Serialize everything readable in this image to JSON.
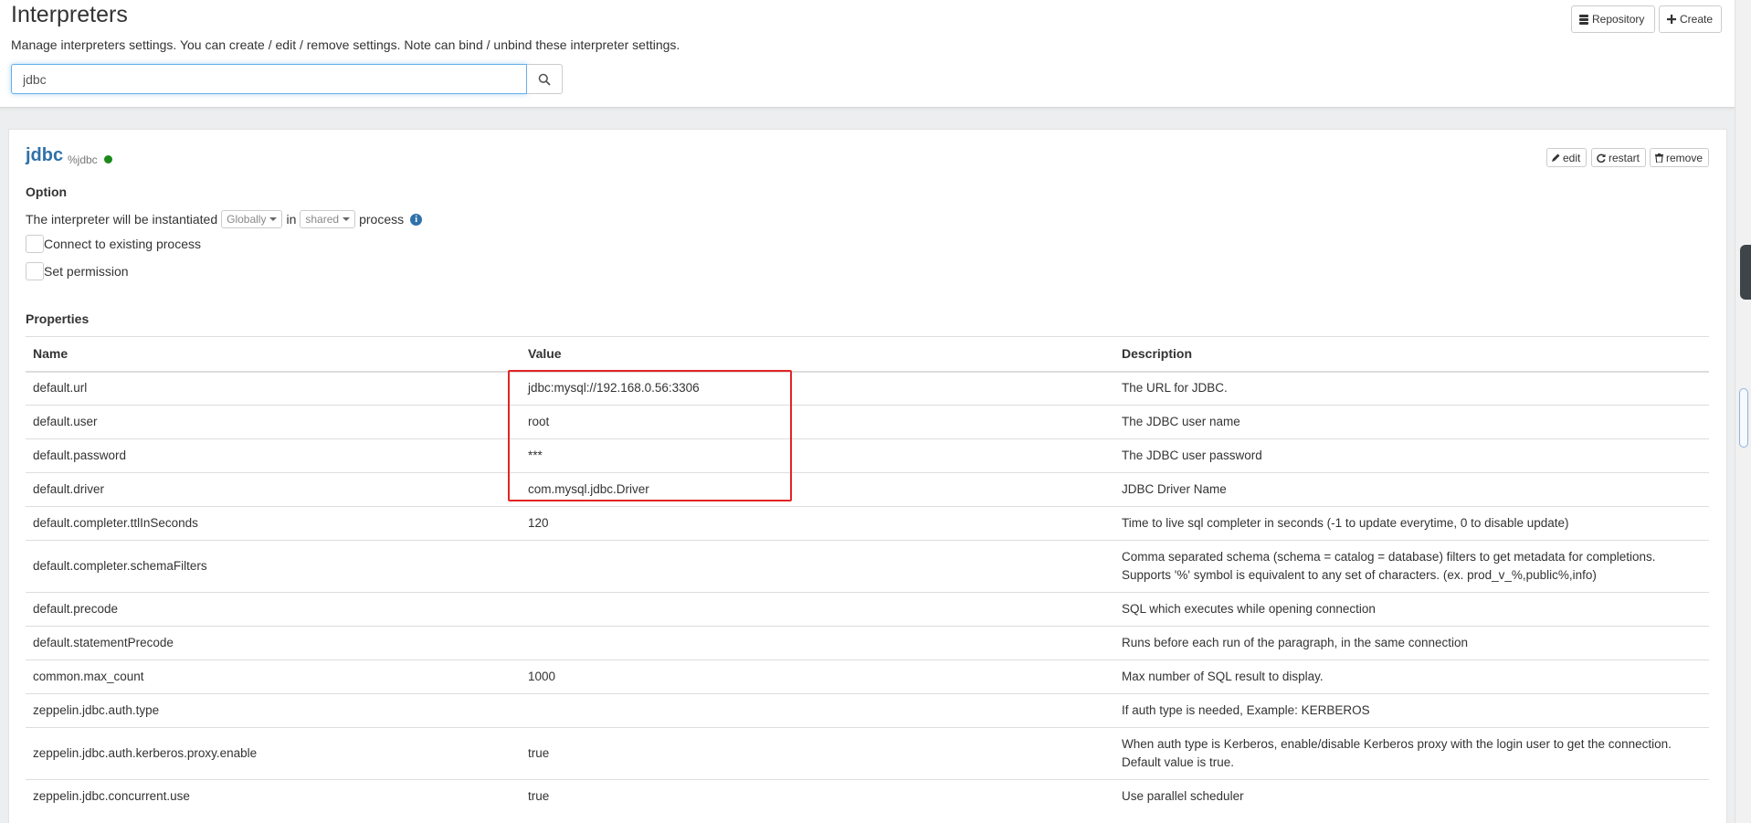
{
  "header": {
    "title": "Interpreters",
    "description": "Manage interpreters settings. You can create / edit / remove settings. Note can bind / unbind these interpreter settings.",
    "search_value": "jdbc",
    "search_icon": "search-icon",
    "repository_label": "Repository",
    "create_label": "Create"
  },
  "interpreter": {
    "name": "jdbc",
    "tag": "%jdbc",
    "status_color": "#1a8a1a",
    "edit_label": "edit",
    "restart_label": "restart",
    "remove_label": "remove",
    "option_title": "Option",
    "option_text_1": "The interpreter will be instantiated",
    "option_scope": "Globally",
    "option_text_2": "in",
    "option_mode": "shared",
    "option_text_3": "process",
    "connect_existing_label": "Connect to existing process",
    "set_permission_label": "Set permission",
    "properties_title": "Properties"
  },
  "properties": {
    "headers": [
      "Name",
      "Value",
      "Description"
    ],
    "rows": [
      {
        "name": "default.url",
        "value": "jdbc:mysql://192.168.0.56:3306",
        "description": "The URL for JDBC."
      },
      {
        "name": "default.user",
        "value": "root",
        "description": "The JDBC user name"
      },
      {
        "name": "default.password",
        "value": "***",
        "description": "The JDBC user password"
      },
      {
        "name": "default.driver",
        "value": "com.mysql.jdbc.Driver",
        "description": "JDBC Driver Name"
      },
      {
        "name": "default.completer.ttlInSeconds",
        "value": "120",
        "description": "Time to live sql completer in seconds (-1 to update everytime, 0 to disable update)"
      },
      {
        "name": "default.completer.schemaFilters",
        "value": "",
        "description": "Comma separated schema (schema = catalog = database) filters to get metadata for completions. Supports '%' symbol is equivalent to any set of characters. (ex. prod_v_%,public%,info)"
      },
      {
        "name": "default.precode",
        "value": "",
        "description": "SQL which executes while opening connection"
      },
      {
        "name": "default.statementPrecode",
        "value": "",
        "description": "Runs before each run of the paragraph, in the same connection"
      },
      {
        "name": "common.max_count",
        "value": "1000",
        "description": "Max number of SQL result to display."
      },
      {
        "name": "zeppelin.jdbc.auth.type",
        "value": "",
        "description": "If auth type is needed, Example: KERBEROS"
      },
      {
        "name": "zeppelin.jdbc.auth.kerberos.proxy.enable",
        "value": "true",
        "description": "When auth type is Kerberos, enable/disable Kerberos proxy with the login user to get the connection. Default value is true."
      },
      {
        "name": "zeppelin.jdbc.concurrent.use",
        "value": "true",
        "description": "Use parallel scheduler"
      }
    ]
  },
  "accent_color": "#3071a9",
  "highlight_color": "#e32525"
}
